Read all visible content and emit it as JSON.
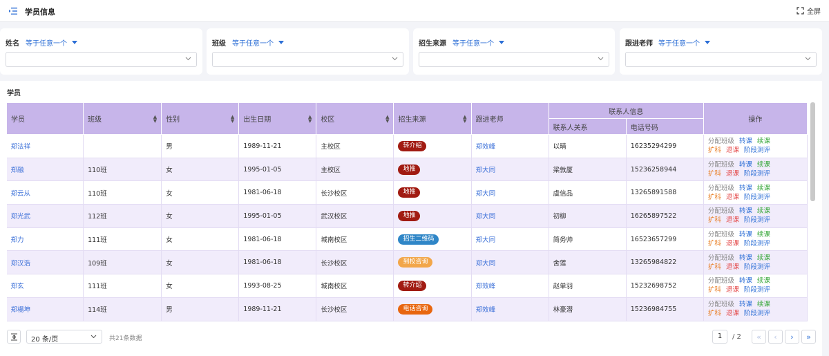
{
  "header": {
    "title": "学员信息",
    "fullscreen_label": "全屏"
  },
  "filters": [
    {
      "label": "姓名",
      "operator": "等于任意一个"
    },
    {
      "label": "班级",
      "operator": "等于任意一个"
    },
    {
      "label": "招生来源",
      "operator": "等于任意一个"
    },
    {
      "label": "跟进老师",
      "operator": "等于任意一个"
    }
  ],
  "table": {
    "caption": "学员",
    "headers": {
      "student": "学员",
      "class": "班级",
      "gender": "性别",
      "birth": "出生日期",
      "campus": "校区",
      "source": "招生来源",
      "teacher": "跟进老师",
      "contact_group": "联系人信息",
      "contact_rel": "联系人关系",
      "phone": "电话号码",
      "actions": "操作"
    },
    "actions": [
      "分配班级",
      "转课",
      "续课",
      "扩科",
      "退课",
      "阶段测评"
    ],
    "action_colors": [
      "#8a8a8a",
      "#2d6fd6",
      "#38a83b",
      "#e87b1f",
      "#e44d4d",
      "#2d6fd6"
    ],
    "source_colors": {
      "转介绍": "#a11b12",
      "地推": "#a11b12",
      "招生二维码": "#2f86c7",
      "到校咨询": "#f2a64a",
      "电话咨询": "#e8660f"
    },
    "rows": [
      {
        "name": "郑法祥",
        "class": "",
        "gender": "男",
        "birth": "1989-11-21",
        "campus": "主校区",
        "source": "转介绍",
        "teacher": "郑效峰",
        "contact": "以晴",
        "phone": "16235294299"
      },
      {
        "name": "郑融",
        "class": "110班",
        "gender": "女",
        "birth": "1995-01-05",
        "campus": "主校区",
        "source": "地推",
        "teacher": "郑大同",
        "contact": "梁敦厦",
        "phone": "15236258944"
      },
      {
        "name": "郑云从",
        "class": "110班",
        "gender": "女",
        "birth": "1981-06-18",
        "campus": "长沙校区",
        "source": "地推",
        "teacher": "郑大同",
        "contact": "虞信品",
        "phone": "13265891588"
      },
      {
        "name": "郑光武",
        "class": "112班",
        "gender": "女",
        "birth": "1995-01-05",
        "campus": "武汉校区",
        "source": "地推",
        "teacher": "郑大同",
        "contact": "初柳",
        "phone": "16265897522"
      },
      {
        "name": "郑力",
        "class": "111班",
        "gender": "女",
        "birth": "1981-06-18",
        "campus": "城南校区",
        "source": "招生二维码",
        "teacher": "郑大同",
        "contact": "简务帅",
        "phone": "16523657299"
      },
      {
        "name": "郑汉浩",
        "class": "109班",
        "gender": "女",
        "birth": "1981-06-18",
        "campus": "长沙校区",
        "source": "到校咨询",
        "teacher": "郑大同",
        "contact": "舍莲",
        "phone": "13265984822"
      },
      {
        "name": "郑玄",
        "class": "111班",
        "gender": "女",
        "birth": "1993-08-25",
        "campus": "城南校区",
        "source": "转介绍",
        "teacher": "郑效峰",
        "contact": "赵单羽",
        "phone": "15232698752"
      },
      {
        "name": "郑楊坤",
        "class": "114班",
        "gender": "男",
        "birth": "1989-11-21",
        "campus": "长沙校区",
        "source": "电话咨询",
        "teacher": "郑效峰",
        "contact": "林豪潜",
        "phone": "15236984755"
      }
    ]
  },
  "pager": {
    "page_size": "20 条/页",
    "total": "共21条数据",
    "current": "1",
    "total_pages": "/ 2"
  }
}
